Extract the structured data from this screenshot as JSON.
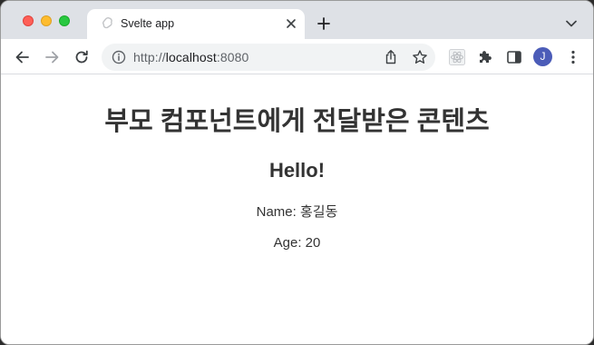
{
  "browser": {
    "tab": {
      "title": "Svelte app",
      "icon": "svelte-icon"
    },
    "address_bar": {
      "scheme": "http://",
      "host": "localhost",
      "port": ":8080"
    },
    "profile_initial": "J",
    "colors": {
      "tab_strip": "#dee1e6",
      "avatar": "#4b5cb8",
      "close": "#fe5f57",
      "minimize": "#febc2e",
      "maximize": "#28c840"
    }
  },
  "page": {
    "heading": "부모 컴포넌트에게 전달받은 콘텐츠",
    "greeting": "Hello!",
    "name_line": "Name: 홍길동",
    "age_line": "Age: 20"
  }
}
